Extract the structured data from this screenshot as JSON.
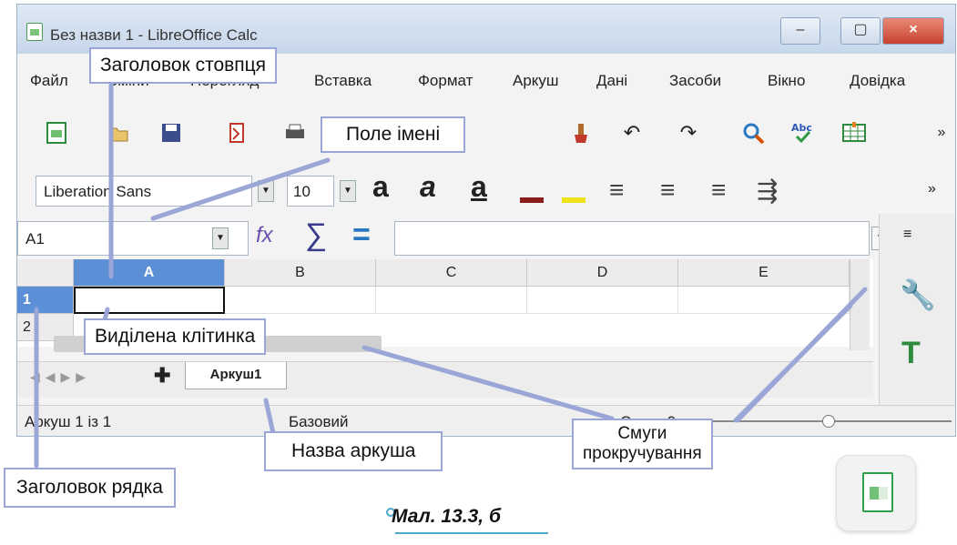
{
  "window": {
    "title": "Без назви 1 - LibreOffice Calc",
    "controls": {
      "minimize": "–",
      "maximize": "▢",
      "close": "×"
    }
  },
  "menu": [
    "Файл",
    "Зміни",
    "Перегляд",
    "Вставка",
    "Формат",
    "Аркуш",
    "Дані",
    "Засоби",
    "Вікно",
    "Довідка"
  ],
  "toolbar1": {
    "icons": [
      "new-spreadsheet-icon",
      "open-icon",
      "save-icon",
      "export-pdf-icon",
      "print-icon",
      "preview-icon",
      "cut-icon",
      "copy-icon",
      "paste-icon",
      "clone-format-icon",
      "undo-icon",
      "redo-icon",
      "find-replace-icon",
      "spelling-icon",
      "table-grid-icon"
    ],
    "overflow": "»"
  },
  "toolbar2": {
    "font_name": "Liberation Sans",
    "font_size": "10",
    "bold": "a",
    "italic": "a",
    "underline": "a",
    "overflow": "»",
    "font_color": "#8b1c1c",
    "highlight_color": "#f0e11a"
  },
  "formula_bar": {
    "name_box": "A1",
    "sum_label": "∑",
    "equals_label": "=",
    "function_label": "fx"
  },
  "grid": {
    "columns": [
      "A",
      "B",
      "C",
      "D",
      "E"
    ],
    "rows": [
      "1",
      "2"
    ],
    "selected_cell": "A1"
  },
  "sheet_tabs": {
    "active": "Аркуш1"
  },
  "status": {
    "sheet_info": "Аркуш 1 із 1",
    "page_style": "Базовий",
    "sum": "Сума=0"
  },
  "callouts": {
    "column_header": "Заголовок стовпця",
    "name_box": "Поле імені",
    "selected_cell": "Виділена клітинка",
    "sheet_name": "Назва аркуша",
    "scrollbars": "Смуги\nпрокручування",
    "row_header": "Заголовок рядка"
  },
  "caption": "Мал. 13.3, б"
}
